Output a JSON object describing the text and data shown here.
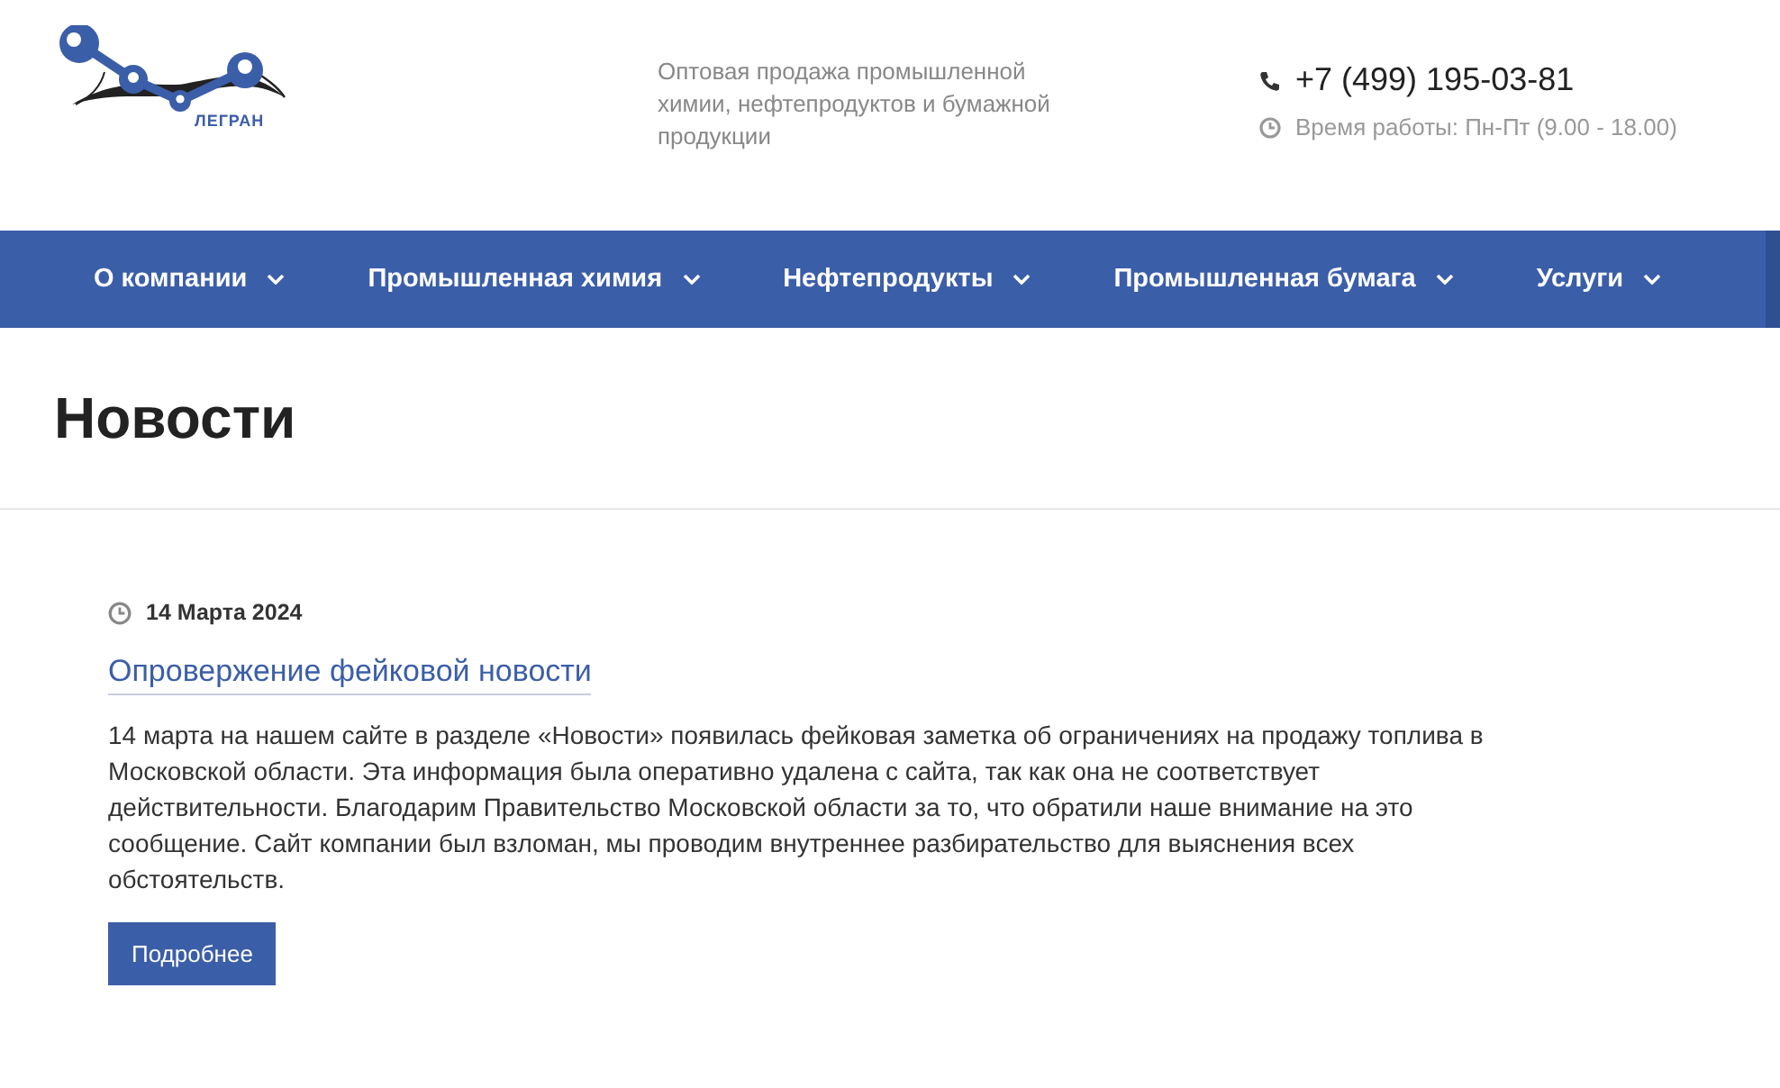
{
  "header": {
    "logo_text": "ЛЕГРАН",
    "tagline": "Оптовая продажа промышленной химии, нефтепродуктов и бумажной продукции",
    "phone": "+7 (499) 195-03-81",
    "hours": "Время работы: Пн-Пт (9.00 - 18.00)"
  },
  "nav": [
    {
      "label": "О компании"
    },
    {
      "label": "Промышленная химия"
    },
    {
      "label": "Нефтепродукты"
    },
    {
      "label": "Промышленная бумага"
    },
    {
      "label": "Услуги"
    }
  ],
  "page_title": "Новости",
  "news": [
    {
      "date": "14 Марта 2024",
      "title": "Опровержение фейковой новости",
      "text": "14 марта на нашем сайте в разделе «Новости» появилась фейковая заметка об ограничениях на продажу топлива в Московской области. Эта информация была оперативно удалена с сайта, так как она не соответствует действительности. Благодарим Правительство Московской области за то, что обратили наше внимание на это сообщение. Сайт компании был взломан, мы проводим внутреннее разбирательство для выяснения всех обстоятельств.",
      "button": "Подробнее"
    }
  ]
}
